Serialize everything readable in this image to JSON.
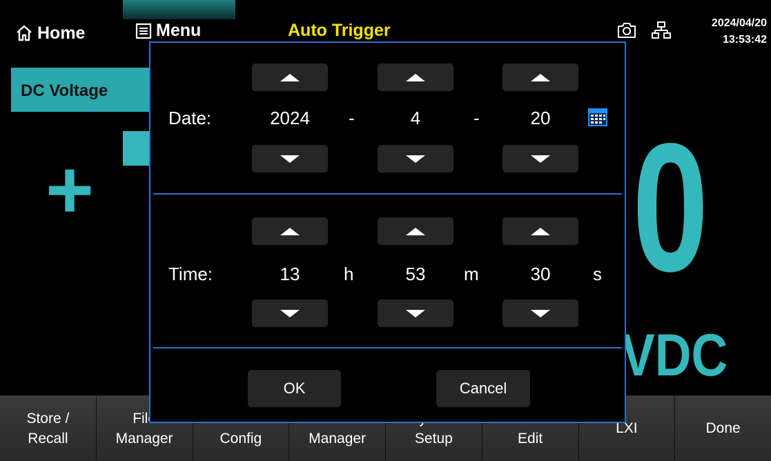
{
  "topbar": {
    "home_label": "Home",
    "menu_label": "Menu",
    "trigger_label": "Auto Trigger",
    "date": "2024/04/20",
    "time": "13:53:42"
  },
  "measurement": {
    "mode": "DC Voltage",
    "sign": "+",
    "visible_digit": "0",
    "unit": "VDC"
  },
  "dialog": {
    "date_label": "Date:",
    "year": "2024",
    "month": "4",
    "day": "20",
    "date_separator": "-",
    "time_label": "Time:",
    "hour": "13",
    "minute": "53",
    "second": "30",
    "hour_unit": "h",
    "minute_unit": "m",
    "second_unit": "s",
    "ok_label": "OK",
    "cancel_label": "Cancel"
  },
  "softkeys": [
    "Store /\nRecall",
    "File\nManager",
    "I/O\nConfig",
    "Test\nManager",
    "System\nSetup",
    "Date Time\nEdit",
    "LXI",
    "Done"
  ],
  "colors": {
    "accent_teal": "#35b8bc",
    "mode_bg": "#2aa8ac",
    "trigger_yellow": "#f3e300",
    "dialog_border": "#2d6fd1",
    "calendar_icon": "#1e90ff"
  },
  "icons": {
    "home": "home-icon",
    "menu": "list-icon",
    "camera": "camera-icon",
    "network": "lan-icon",
    "calendar": "calendar-icon"
  }
}
